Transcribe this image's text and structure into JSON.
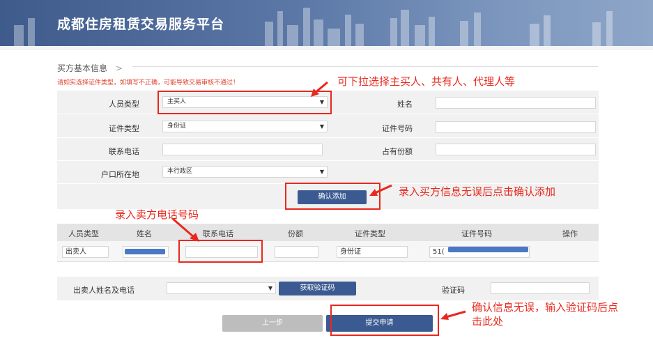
{
  "header": {
    "title": "成都住房租赁交易服务平台"
  },
  "section": {
    "title": "买方基本信息",
    "chevron": ">",
    "warning": "请如实选择证件类型，如填写不正确，可能导致交易审核不通过！"
  },
  "buyer_form": {
    "person_type": {
      "label": "人员类型",
      "value": "主买人"
    },
    "name": {
      "label": "姓名",
      "value": ""
    },
    "id_type": {
      "label": "证件类型",
      "value": "身份证"
    },
    "id_number": {
      "label": "证件号码",
      "value": ""
    },
    "phone": {
      "label": "联系电话",
      "value": ""
    },
    "share": {
      "label": "占有份额",
      "value": ""
    },
    "household": {
      "label": "户口所在地",
      "value": "本行政区"
    },
    "confirm_button": "确认添加"
  },
  "seller_table": {
    "headers": [
      "人员类型",
      "姓名",
      "联系电话",
      "份额",
      "证件类型",
      "证件号码",
      "操作"
    ],
    "row": {
      "person_type": "出卖人",
      "name": "",
      "phone": "",
      "share": "",
      "id_type": "身份证",
      "id_number_prefix": "51("
    }
  },
  "verify": {
    "seller_label": "出卖人姓名及电话",
    "seller_select": "",
    "get_code_button": "获取验证码",
    "code_label": "验证码",
    "code_value": ""
  },
  "footer": {
    "prev_button": "上一步",
    "submit_button": "提交申请"
  },
  "annotations": {
    "dropdown_hint": "可下拉选择主买人、共有人、代理人等",
    "confirm_hint": "录入买方信息无误后点击确认添加",
    "seller_phone_hint": "录入卖方电话号码",
    "submit_hint_line1": "确认信息无误，输入验证码后点",
    "submit_hint_line2": "击此处"
  },
  "colors": {
    "brand": "#3c5a92",
    "annotation_red": "#e8281e",
    "warning_red": "#e0442f"
  },
  "icons": {
    "select_arrow": "caret-down-icon",
    "section_chevron": "chevron-right-icon"
  }
}
